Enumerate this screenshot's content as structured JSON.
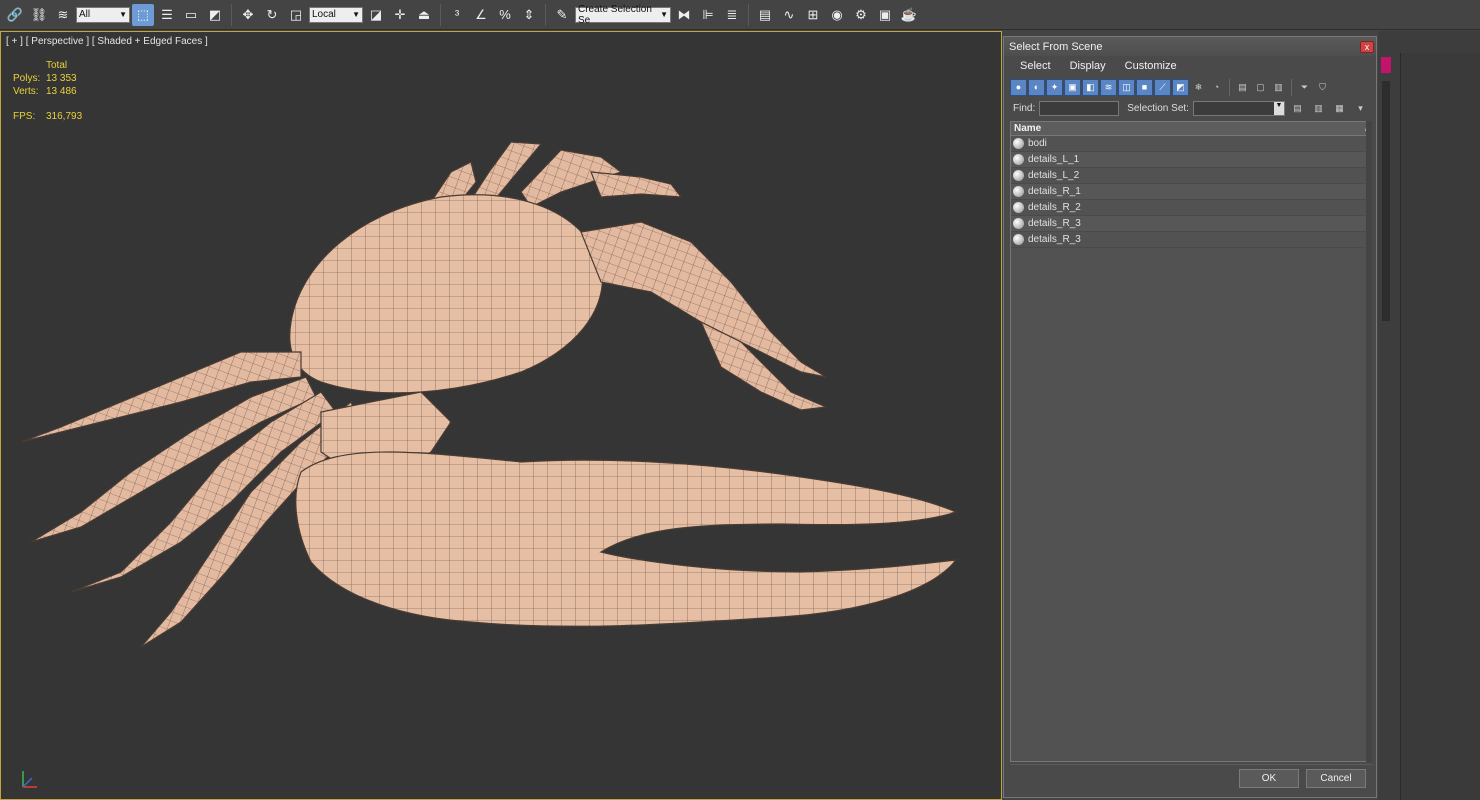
{
  "toolbar": {
    "selection_filter": "All",
    "coordinate_system": "Local",
    "named_selection_placeholder": "Create Selection Se"
  },
  "viewport": {
    "label": "[ + ] [ Perspective ] [ Shaded + Edged Faces ]",
    "stats": {
      "header": "Total",
      "polys_label": "Polys:",
      "polys_value": "13 353",
      "verts_label": "Verts:",
      "verts_value": "13 486",
      "fps_label": "FPS:",
      "fps_value": "316,793"
    }
  },
  "dialog": {
    "title": "Select From Scene",
    "close_label": "x",
    "menu": [
      "Select",
      "Display",
      "Customize"
    ],
    "find_label": "Find:",
    "selection_set_label": "Selection Set:",
    "column_name": "Name",
    "objects": [
      "bodi",
      "details_L_1",
      "details_L_2",
      "details_R_1",
      "details_R_2",
      "details_R_3",
      "details_R_3"
    ],
    "ok_label": "OK",
    "cancel_label": "Cancel"
  },
  "colors": {
    "viewport_bg": "#353535",
    "mesh_fill": "#e6bea4",
    "stats_text": "#e8d23a",
    "active_button": "#6d9bd6"
  }
}
